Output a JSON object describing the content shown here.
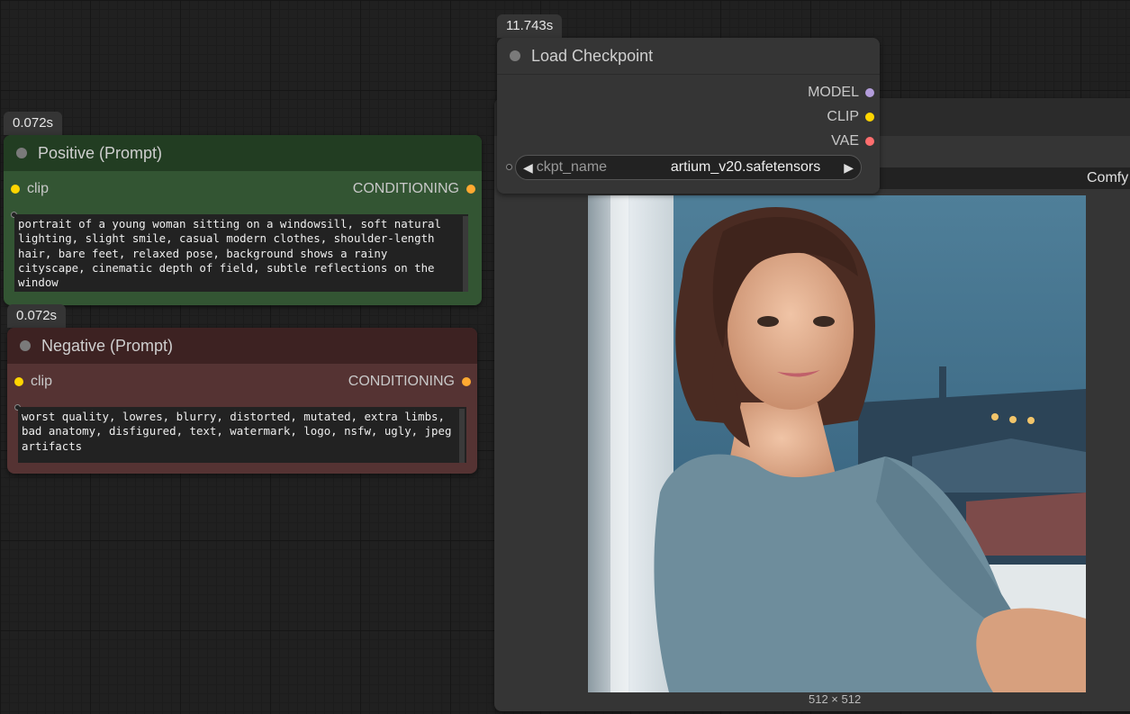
{
  "nodes": {
    "load_checkpoint": {
      "time": "11.743s",
      "title": "Load Checkpoint",
      "outputs": [
        {
          "label": "MODEL",
          "color": "#b39ddb"
        },
        {
          "label": "CLIP",
          "color": "#ffd500"
        },
        {
          "label": "VAE",
          "color": "#ff6e6e"
        }
      ],
      "widget": {
        "name": "ckpt_name",
        "value": "artium_v20.safetensors",
        "left_arrow": "◀",
        "right_arrow": "▶"
      }
    },
    "positive": {
      "time": "0.072s",
      "title": "Positive (Prompt)",
      "input_label": "clip",
      "output_label": "CONDITIONING",
      "text": "portrait of a young woman sitting on a windowsill, soft natural lighting, slight smile, casual modern clothes, shoulder-length hair, bare feet, relaxed pose, background shows a rainy cityscape, cinematic depth of field, subtle reflections on the window"
    },
    "negative": {
      "time": "0.072s",
      "title": "Negative (Prompt)",
      "input_label": "clip",
      "output_label": "CONDITIONING",
      "text": "worst quality, lowres, blurry, distorted, mutated, extra limbs, bad anatomy, disfigured, text, watermark, logo, nsfw, ugly, jpeg artifacts"
    },
    "save_image": {
      "filename_prefix_value": "Comfy",
      "image_size": "512 × 512"
    }
  },
  "colors": {
    "input_dot": "#ffd500",
    "output_dot": "#ffa931",
    "positive_body": "#335533",
    "positive_title": "#223d22",
    "negative_body": "#553333",
    "negative_title": "#3d2222"
  }
}
